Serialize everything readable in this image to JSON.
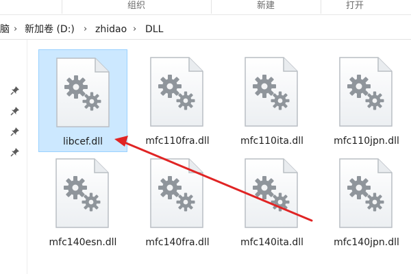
{
  "ribbon": {
    "groups": [
      "组织",
      "新建",
      "打开"
    ]
  },
  "address_bar": {
    "crumbs": [
      "脑",
      "新加卷 (D:)",
      "zhidao",
      "DLL"
    ],
    "separator_icon": "chevron-right-icon"
  },
  "navigation_pane": {
    "pins": [
      "pin-icon",
      "pin-icon",
      "pin-icon",
      "pin-icon"
    ]
  },
  "files": [
    {
      "name": "libcef.dll",
      "icon": "dll-file-icon",
      "selected": true
    },
    {
      "name": "mfc110fra.dll",
      "icon": "dll-file-icon",
      "selected": false
    },
    {
      "name": "mfc110ita.dll",
      "icon": "dll-file-icon",
      "selected": false
    },
    {
      "name": "mfc110jpn.dll",
      "icon": "dll-file-icon",
      "selected": false
    },
    {
      "name": "mfc140esn.dll",
      "icon": "dll-file-icon",
      "selected": false
    },
    {
      "name": "mfc140fra.dll",
      "icon": "dll-file-icon",
      "selected": false
    },
    {
      "name": "mfc140ita.dll",
      "icon": "dll-file-icon",
      "selected": false
    },
    {
      "name": "mfc140jpn.dll",
      "icon": "dll-file-icon",
      "selected": false
    }
  ],
  "annotation": {
    "type": "red-arrow",
    "color": "#e02424",
    "points_to": "libcef.dll"
  },
  "colors": {
    "selection_fill": "#cce8ff",
    "selection_border": "#99d1ff"
  }
}
